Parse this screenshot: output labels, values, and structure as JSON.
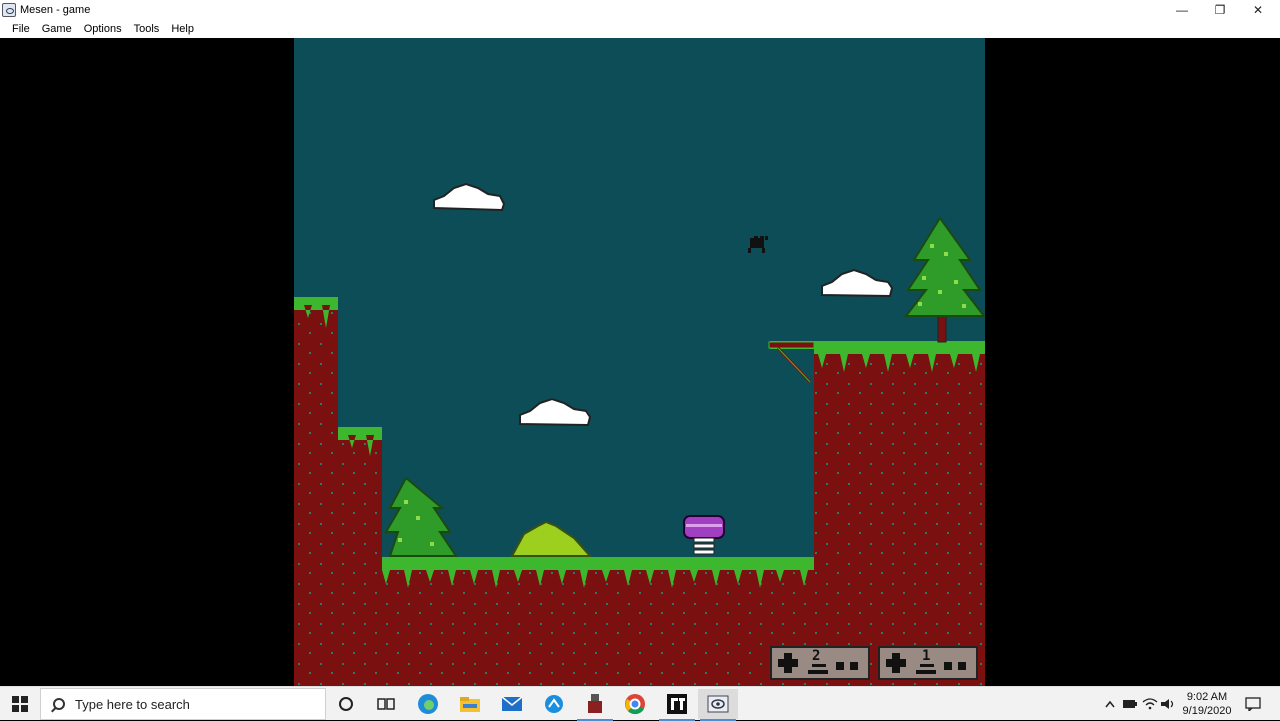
{
  "window": {
    "title": "Mesen - game",
    "controls": {
      "minimize": "—",
      "restore": "❐",
      "close": "✕"
    }
  },
  "menu": {
    "items": [
      "File",
      "Game",
      "Options",
      "Tools",
      "Help"
    ]
  },
  "game": {
    "sky_color": "#0d4d58",
    "dirt_color": "#7a1010",
    "grass_color": "#3db82e",
    "player_badges": [
      "2",
      "1"
    ]
  },
  "taskbar": {
    "search_placeholder": "Type here to search",
    "clock_time": "9:02 AM",
    "clock_date": "9/19/2020",
    "apps": [
      "cortana-icon",
      "task-view-icon",
      "edge-icon",
      "file-explorer-icon",
      "mail-icon",
      "network-app-icon",
      "usb-app-icon",
      "chrome-icon",
      "ft-app-icon",
      "mesen-icon"
    ]
  }
}
